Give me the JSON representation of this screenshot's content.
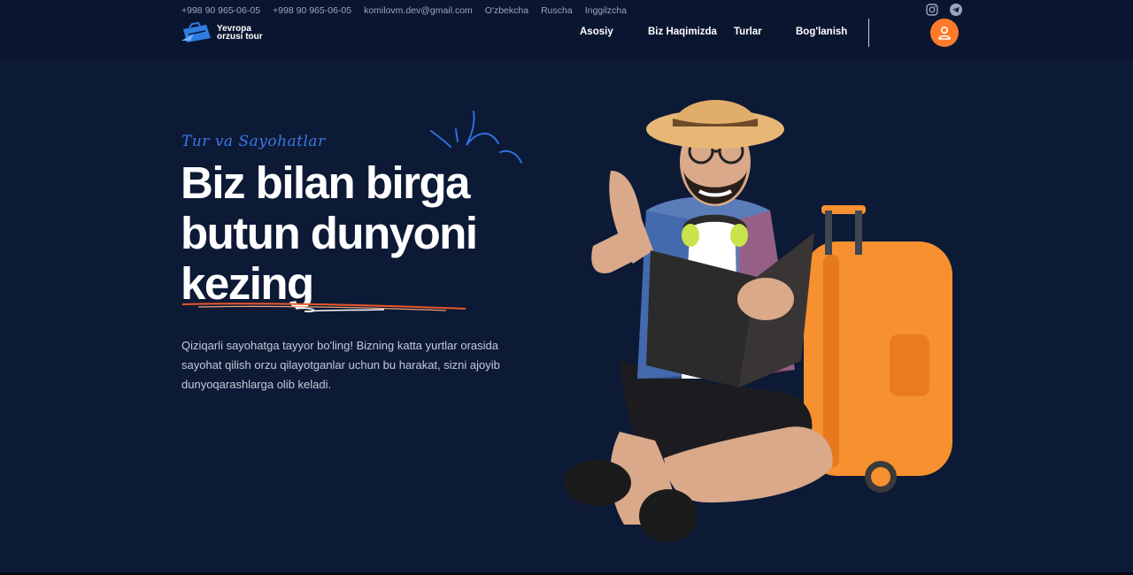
{
  "topbar": {
    "phone1": "+998 90 965-06-05",
    "phone2": "+998 90 965-06-05",
    "email": "komilovm.dev@gmail.com",
    "lang_uz": "O'zbekcha",
    "lang_ru": "Ruscha",
    "lang_en": "Inggilzcha"
  },
  "social": {
    "icons": [
      "instagram-icon",
      "telegram-icon"
    ]
  },
  "logo": {
    "line1": "Yevropa",
    "line2": "orzusi tour"
  },
  "nav": {
    "home": "Asosiy",
    "about": "Biz Haqimizda",
    "tours": "Turlar",
    "contact": "Bog'lanish"
  },
  "hero": {
    "eyebrow": "Tur va Sayohatlar",
    "headline_line1": "Biz bilan birga",
    "headline_line2": "butun dunyoni",
    "headline_line3": "kezing",
    "description": "Qiziqarli sayohatga tayyor bo'ling! Bizning katta yurtlar orasida sayohat qilish orzu qilayotganlar uchun bu harakat, sizni ajoyib dunyoqarashlarga olib keladi."
  },
  "colors": {
    "background": "#0d1a36",
    "header": "#0a1530",
    "accent_orange": "#ff7a2b",
    "accent_blue": "#3b78e7"
  }
}
